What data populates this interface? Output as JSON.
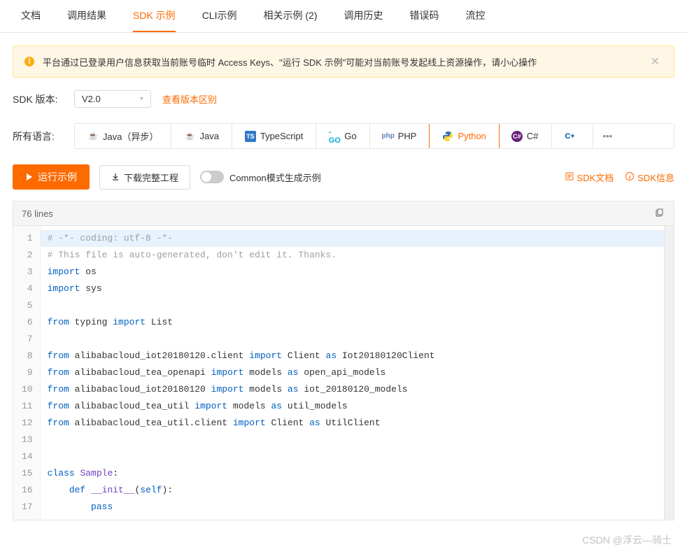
{
  "tabs": [
    {
      "label": "文档"
    },
    {
      "label": "调用结果"
    },
    {
      "label": "SDK 示例",
      "active": true
    },
    {
      "label": "CLI示例"
    },
    {
      "label": "相关示例 (2)"
    },
    {
      "label": "调用历史"
    },
    {
      "label": "错误码"
    },
    {
      "label": "流控"
    }
  ],
  "alert": {
    "text": "平台通过已登录用户信息获取当前账号临时 Access Keys、\"运行 SDK 示例\"可能对当前账号发起线上资源操作，请小心操作"
  },
  "sdk_version": {
    "label": "SDK 版本:",
    "value": "V2.0",
    "link": "查看版本区别"
  },
  "languages": {
    "label": "所有语言:",
    "items": [
      {
        "label": "Java（异步）",
        "icon": "java"
      },
      {
        "label": "Java",
        "icon": "java"
      },
      {
        "label": "TypeScript",
        "icon": "ts"
      },
      {
        "label": "Go",
        "icon": "go"
      },
      {
        "label": "PHP",
        "icon": "php"
      },
      {
        "label": "Python",
        "icon": "py",
        "active": true
      },
      {
        "label": "C#",
        "icon": "cs"
      },
      {
        "label": "",
        "icon": "cpp"
      }
    ],
    "more": "•••"
  },
  "actions": {
    "run": "运行示例",
    "download": "下载完整工程",
    "mode_label": "Common模式生成示例",
    "sdk_doc": "SDK文档",
    "sdk_info": "SDK信息"
  },
  "code": {
    "lines_label": "76 lines",
    "watermark": "CSDN @浮云—骑士",
    "lines": [
      {
        "n": 1,
        "hl": true,
        "tokens": [
          {
            "t": "# -*- coding: utf-8 -*-",
            "c": "comment"
          }
        ]
      },
      {
        "n": 2,
        "tokens": [
          {
            "t": "# This file is auto-generated, don't edit it. Thanks.",
            "c": "comment"
          }
        ]
      },
      {
        "n": 3,
        "tokens": [
          {
            "t": "import",
            "c": "kw"
          },
          {
            "t": " os"
          }
        ]
      },
      {
        "n": 4,
        "tokens": [
          {
            "t": "import",
            "c": "kw"
          },
          {
            "t": " sys"
          }
        ]
      },
      {
        "n": 5,
        "tokens": []
      },
      {
        "n": 6,
        "tokens": [
          {
            "t": "from",
            "c": "kw"
          },
          {
            "t": " typing "
          },
          {
            "t": "import",
            "c": "kw"
          },
          {
            "t": " List"
          }
        ]
      },
      {
        "n": 7,
        "tokens": []
      },
      {
        "n": 8,
        "tokens": [
          {
            "t": "from",
            "c": "kw"
          },
          {
            "t": " alibabacloud_iot20180120.client "
          },
          {
            "t": "import",
            "c": "kw"
          },
          {
            "t": " Client "
          },
          {
            "t": "as",
            "c": "kw"
          },
          {
            "t": " Iot20180120Client"
          }
        ]
      },
      {
        "n": 9,
        "tokens": [
          {
            "t": "from",
            "c": "kw"
          },
          {
            "t": " alibabacloud_tea_openapi "
          },
          {
            "t": "import",
            "c": "kw"
          },
          {
            "t": " models "
          },
          {
            "t": "as",
            "c": "kw"
          },
          {
            "t": " open_api_models"
          }
        ]
      },
      {
        "n": 10,
        "tokens": [
          {
            "t": "from",
            "c": "kw"
          },
          {
            "t": " alibabacloud_iot20180120 "
          },
          {
            "t": "import",
            "c": "kw"
          },
          {
            "t": " models "
          },
          {
            "t": "as",
            "c": "kw"
          },
          {
            "t": " iot_20180120_models"
          }
        ]
      },
      {
        "n": 11,
        "tokens": [
          {
            "t": "from",
            "c": "kw"
          },
          {
            "t": " alibabacloud_tea_util "
          },
          {
            "t": "import",
            "c": "kw"
          },
          {
            "t": " models "
          },
          {
            "t": "as",
            "c": "kw"
          },
          {
            "t": " util_models"
          }
        ]
      },
      {
        "n": 12,
        "tokens": [
          {
            "t": "from",
            "c": "kw"
          },
          {
            "t": " alibabacloud_tea_util.client "
          },
          {
            "t": "import",
            "c": "kw"
          },
          {
            "t": " Client "
          },
          {
            "t": "as",
            "c": "kw"
          },
          {
            "t": " UtilClient"
          }
        ]
      },
      {
        "n": 13,
        "tokens": []
      },
      {
        "n": 14,
        "tokens": []
      },
      {
        "n": 15,
        "tokens": [
          {
            "t": "class",
            "c": "kw"
          },
          {
            "t": " "
          },
          {
            "t": "Sample",
            "c": "fn"
          },
          {
            "t": ":"
          }
        ]
      },
      {
        "n": 16,
        "tokens": [
          {
            "t": "    "
          },
          {
            "t": "def",
            "c": "kw"
          },
          {
            "t": " "
          },
          {
            "t": "__init__",
            "c": "fn"
          },
          {
            "t": "("
          },
          {
            "t": "self",
            "c": "self"
          },
          {
            "t": "):"
          }
        ]
      },
      {
        "n": 17,
        "tokens": [
          {
            "t": "        "
          },
          {
            "t": "pass",
            "c": "kw"
          }
        ]
      }
    ]
  }
}
